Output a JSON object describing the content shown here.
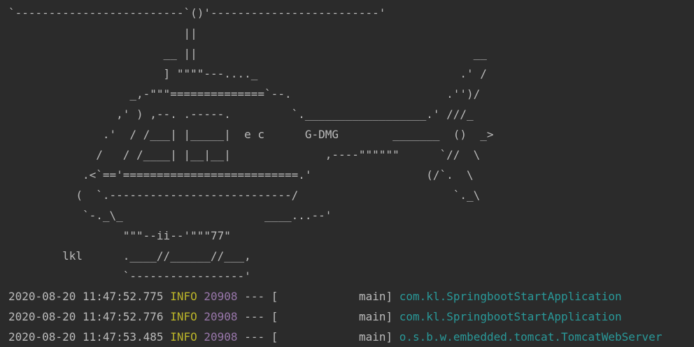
{
  "console": {
    "banner_lines": [
      "`-------------------------`()'-------------------------'",
      "                          ||",
      "                       __ ||                                         __",
      "                       ] \"\"\"\"---...._                              .' /",
      "                  _,-\"\"\"==============`--.                       .'')/",
      "                ,' ) ,--. .-----.         `.__________________.' ///_",
      "              .'  / /___| |_____|  e c      G-DMG        _______  ()  _>",
      "             /   / /____| |__|__|              ,----\"\"\"\"\"\"      `//  \\",
      "           .<`=='==========================.'                 (/`.  \\",
      "          (  `.---------------------------/                       `._\\",
      "           `-._\\_                     ____...--'",
      "                 \"\"\"--ii--'\"\"\"77\"",
      "        lkl      .____//______//___,",
      "                 `-----------------'"
    ],
    "log_lines": [
      {
        "timestamp": "2020-08-20 11:47:52.775",
        "level": "INFO",
        "pid": "20908",
        "separator": "--- [",
        "thread": "           main]",
        "logger": "com.kl.SpringbootStartApplication"
      },
      {
        "timestamp": "2020-08-20 11:47:52.776",
        "level": "INFO",
        "pid": "20908",
        "separator": "--- [",
        "thread": "           main]",
        "logger": "com.kl.SpringbootStartApplication"
      },
      {
        "timestamp": "2020-08-20 11:47:53.485",
        "level": "INFO",
        "pid": "20908",
        "separator": "--- [",
        "thread": "           main]",
        "logger": "o.s.b.w.embedded.tomcat.TomcatWebServer"
      }
    ]
  }
}
